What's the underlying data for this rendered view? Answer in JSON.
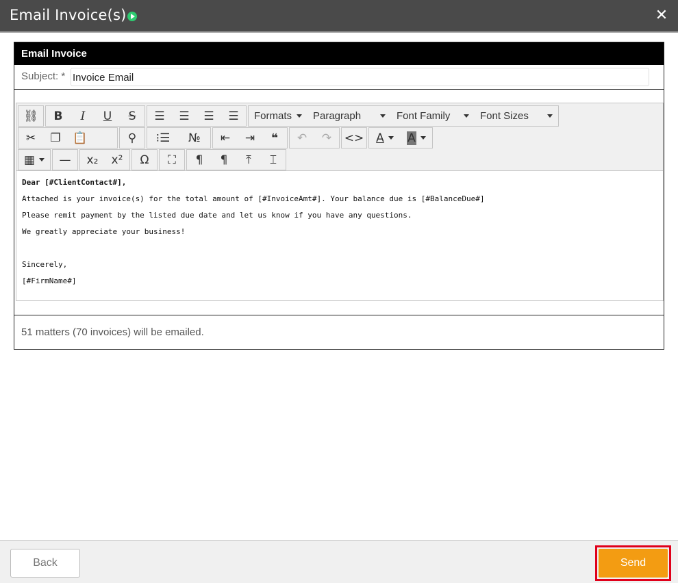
{
  "window": {
    "title": "Email Invoice(s)",
    "close_symbol": "✕"
  },
  "panel": {
    "header": "Email Invoice",
    "subject_label": "Subject: *",
    "subject_value": "Invoice Email"
  },
  "toolbar": {
    "formats": "Formats",
    "paragraph": "Paragraph",
    "font_family": "Font Family",
    "font_sizes": "Font Sizes"
  },
  "body_lines": [
    "Dear [#ClientContact#],",
    "Attached is your invoice(s) for the total amount of [#InvoiceAmt#]. Your balance due is [#BalanceDue#]",
    "Please remit payment by the listed due date and let us know if you have any questions.",
    "We greatly appreciate your business!",
    "",
    "Sincerely,",
    "[#FirmName#]"
  ],
  "summary": "51 matters (70 invoices) will be emailed.",
  "buttons": {
    "back": "Back",
    "send": "Send"
  }
}
